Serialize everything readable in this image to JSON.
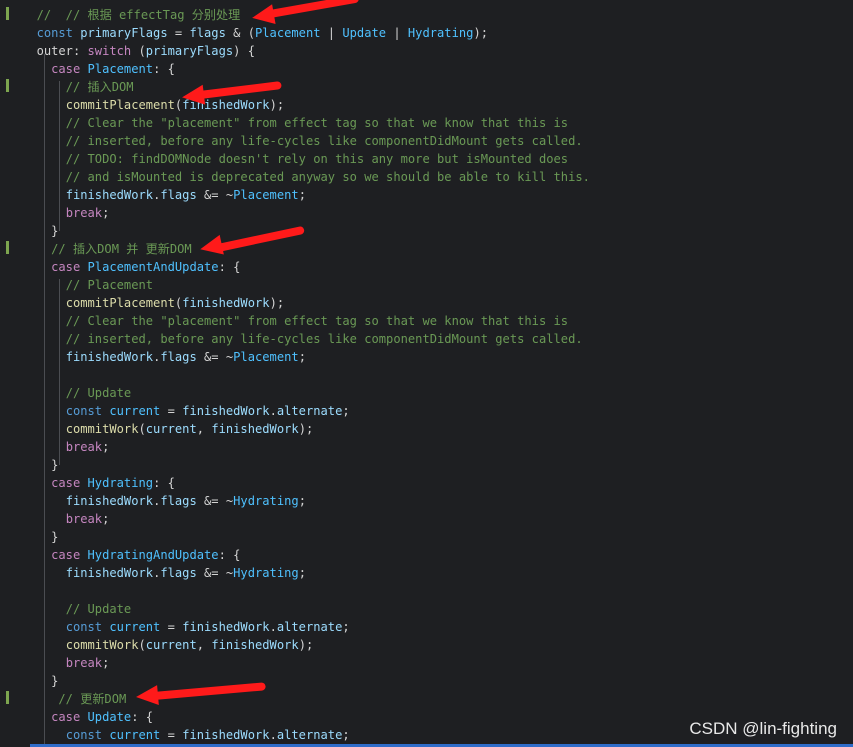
{
  "code_lines": [
    {
      "indent": "  ",
      "tokens": [
        [
          "c",
          "//  // 根据 effectTag 分别处理"
        ]
      ]
    },
    {
      "indent": "  ",
      "tokens": [
        [
          "kw",
          "const "
        ],
        [
          "v",
          "primaryFlags"
        ],
        [
          "p",
          " = "
        ],
        [
          "v",
          "flags"
        ],
        [
          "p",
          " & ("
        ],
        [
          "t",
          "Placement"
        ],
        [
          "p",
          " | "
        ],
        [
          "t",
          "Update"
        ],
        [
          "p",
          " | "
        ],
        [
          "t",
          "Hydrating"
        ],
        [
          "p",
          ");"
        ]
      ]
    },
    {
      "indent": "  ",
      "tokens": [
        [
          "p",
          "outer"
        ],
        [
          "p",
          ": "
        ],
        [
          "k",
          "switch"
        ],
        [
          "p",
          " ("
        ],
        [
          "v",
          "primaryFlags"
        ],
        [
          "p",
          ") {"
        ]
      ]
    },
    {
      "indent": "    ",
      "tokens": [
        [
          "k",
          "case "
        ],
        [
          "t",
          "Placement"
        ],
        [
          "p",
          ": {"
        ]
      ]
    },
    {
      "indent": "      ",
      "tokens": [
        [
          "c",
          "// 插入DOM"
        ]
      ]
    },
    {
      "indent": "      ",
      "tokens": [
        [
          "f",
          "commitPlacement"
        ],
        [
          "p",
          "("
        ],
        [
          "v",
          "finishedWork"
        ],
        [
          "p",
          ");"
        ]
      ]
    },
    {
      "indent": "      ",
      "tokens": [
        [
          "c",
          "// Clear the \"placement\" from effect tag so that we know that this is"
        ]
      ]
    },
    {
      "indent": "      ",
      "tokens": [
        [
          "c",
          "// inserted, before any life-cycles like componentDidMount gets called."
        ]
      ]
    },
    {
      "indent": "      ",
      "tokens": [
        [
          "c",
          "// TODO: findDOMNode doesn't rely on this any more but isMounted does"
        ]
      ]
    },
    {
      "indent": "      ",
      "tokens": [
        [
          "c",
          "// and isMounted is deprecated anyway so we should be able to kill this."
        ]
      ]
    },
    {
      "indent": "      ",
      "tokens": [
        [
          "v",
          "finishedWork"
        ],
        [
          "p",
          "."
        ],
        [
          "v",
          "flags"
        ],
        [
          "p",
          " &= ~"
        ],
        [
          "t",
          "Placement"
        ],
        [
          "p",
          ";"
        ]
      ]
    },
    {
      "indent": "      ",
      "tokens": [
        [
          "k",
          "break"
        ],
        [
          "p",
          ";"
        ]
      ]
    },
    {
      "indent": "    ",
      "tokens": [
        [
          "p",
          "}"
        ]
      ]
    },
    {
      "indent": "    ",
      "tokens": [
        [
          "c",
          "// 插入DOM 并 更新DOM"
        ]
      ]
    },
    {
      "indent": "    ",
      "tokens": [
        [
          "k",
          "case "
        ],
        [
          "t",
          "PlacementAndUpdate"
        ],
        [
          "p",
          ": {"
        ]
      ]
    },
    {
      "indent": "      ",
      "tokens": [
        [
          "c",
          "// Placement"
        ]
      ]
    },
    {
      "indent": "      ",
      "tokens": [
        [
          "f",
          "commitPlacement"
        ],
        [
          "p",
          "("
        ],
        [
          "v",
          "finishedWork"
        ],
        [
          "p",
          ");"
        ]
      ]
    },
    {
      "indent": "      ",
      "tokens": [
        [
          "c",
          "// Clear the \"placement\" from effect tag so that we know that this is"
        ]
      ]
    },
    {
      "indent": "      ",
      "tokens": [
        [
          "c",
          "// inserted, before any life-cycles like componentDidMount gets called."
        ]
      ]
    },
    {
      "indent": "      ",
      "tokens": [
        [
          "v",
          "finishedWork"
        ],
        [
          "p",
          "."
        ],
        [
          "v",
          "flags"
        ],
        [
          "p",
          " &= ~"
        ],
        [
          "t",
          "Placement"
        ],
        [
          "p",
          ";"
        ]
      ]
    },
    {
      "indent": "",
      "tokens": []
    },
    {
      "indent": "      ",
      "tokens": [
        [
          "c",
          "// Update"
        ]
      ]
    },
    {
      "indent": "      ",
      "tokens": [
        [
          "kw",
          "const "
        ],
        [
          "t",
          "current"
        ],
        [
          "p",
          " = "
        ],
        [
          "v",
          "finishedWork"
        ],
        [
          "p",
          "."
        ],
        [
          "v",
          "alternate"
        ],
        [
          "p",
          ";"
        ]
      ]
    },
    {
      "indent": "      ",
      "tokens": [
        [
          "f",
          "commitWork"
        ],
        [
          "p",
          "("
        ],
        [
          "v",
          "current"
        ],
        [
          "p",
          ", "
        ],
        [
          "v",
          "finishedWork"
        ],
        [
          "p",
          ");"
        ]
      ]
    },
    {
      "indent": "      ",
      "tokens": [
        [
          "k",
          "break"
        ],
        [
          "p",
          ";"
        ]
      ]
    },
    {
      "indent": "    ",
      "tokens": [
        [
          "p",
          "}"
        ]
      ]
    },
    {
      "indent": "    ",
      "tokens": [
        [
          "k",
          "case "
        ],
        [
          "t",
          "Hydrating"
        ],
        [
          "p",
          ": {"
        ]
      ]
    },
    {
      "indent": "      ",
      "tokens": [
        [
          "v",
          "finishedWork"
        ],
        [
          "p",
          "."
        ],
        [
          "v",
          "flags"
        ],
        [
          "p",
          " &= ~"
        ],
        [
          "t",
          "Hydrating"
        ],
        [
          "p",
          ";"
        ]
      ]
    },
    {
      "indent": "      ",
      "tokens": [
        [
          "k",
          "break"
        ],
        [
          "p",
          ";"
        ]
      ]
    },
    {
      "indent": "    ",
      "tokens": [
        [
          "p",
          "}"
        ]
      ]
    },
    {
      "indent": "    ",
      "tokens": [
        [
          "k",
          "case "
        ],
        [
          "t",
          "HydratingAndUpdate"
        ],
        [
          "p",
          ": {"
        ]
      ]
    },
    {
      "indent": "      ",
      "tokens": [
        [
          "v",
          "finishedWork"
        ],
        [
          "p",
          "."
        ],
        [
          "v",
          "flags"
        ],
        [
          "p",
          " &= ~"
        ],
        [
          "t",
          "Hydrating"
        ],
        [
          "p",
          ";"
        ]
      ]
    },
    {
      "indent": "",
      "tokens": []
    },
    {
      "indent": "      ",
      "tokens": [
        [
          "c",
          "// Update"
        ]
      ]
    },
    {
      "indent": "      ",
      "tokens": [
        [
          "kw",
          "const "
        ],
        [
          "t",
          "current"
        ],
        [
          "p",
          " = "
        ],
        [
          "v",
          "finishedWork"
        ],
        [
          "p",
          "."
        ],
        [
          "v",
          "alternate"
        ],
        [
          "p",
          ";"
        ]
      ]
    },
    {
      "indent": "      ",
      "tokens": [
        [
          "f",
          "commitWork"
        ],
        [
          "p",
          "("
        ],
        [
          "v",
          "current"
        ],
        [
          "p",
          ", "
        ],
        [
          "v",
          "finishedWork"
        ],
        [
          "p",
          ");"
        ]
      ]
    },
    {
      "indent": "      ",
      "tokens": [
        [
          "k",
          "break"
        ],
        [
          "p",
          ";"
        ]
      ]
    },
    {
      "indent": "    ",
      "tokens": [
        [
          "p",
          "}"
        ]
      ]
    },
    {
      "indent": "     ",
      "tokens": [
        [
          "c",
          "// 更新DOM"
        ]
      ]
    },
    {
      "indent": "    ",
      "tokens": [
        [
          "k",
          "case "
        ],
        [
          "t",
          "Update"
        ],
        [
          "p",
          ": {"
        ]
      ]
    },
    {
      "indent": "      ",
      "tokens": [
        [
          "kw",
          "const "
        ],
        [
          "t",
          "current"
        ],
        [
          "p",
          " = "
        ],
        [
          "v",
          "finishedWork"
        ],
        [
          "p",
          "."
        ],
        [
          "v",
          "alternate"
        ],
        [
          "p",
          ";"
        ]
      ]
    }
  ],
  "watermark": "CSDN @lin-fighting",
  "colors": {
    "background": "#1e1f22",
    "arrow": "#ff1a1a",
    "comment": "#6a9955",
    "keyword": "#c586c0"
  }
}
